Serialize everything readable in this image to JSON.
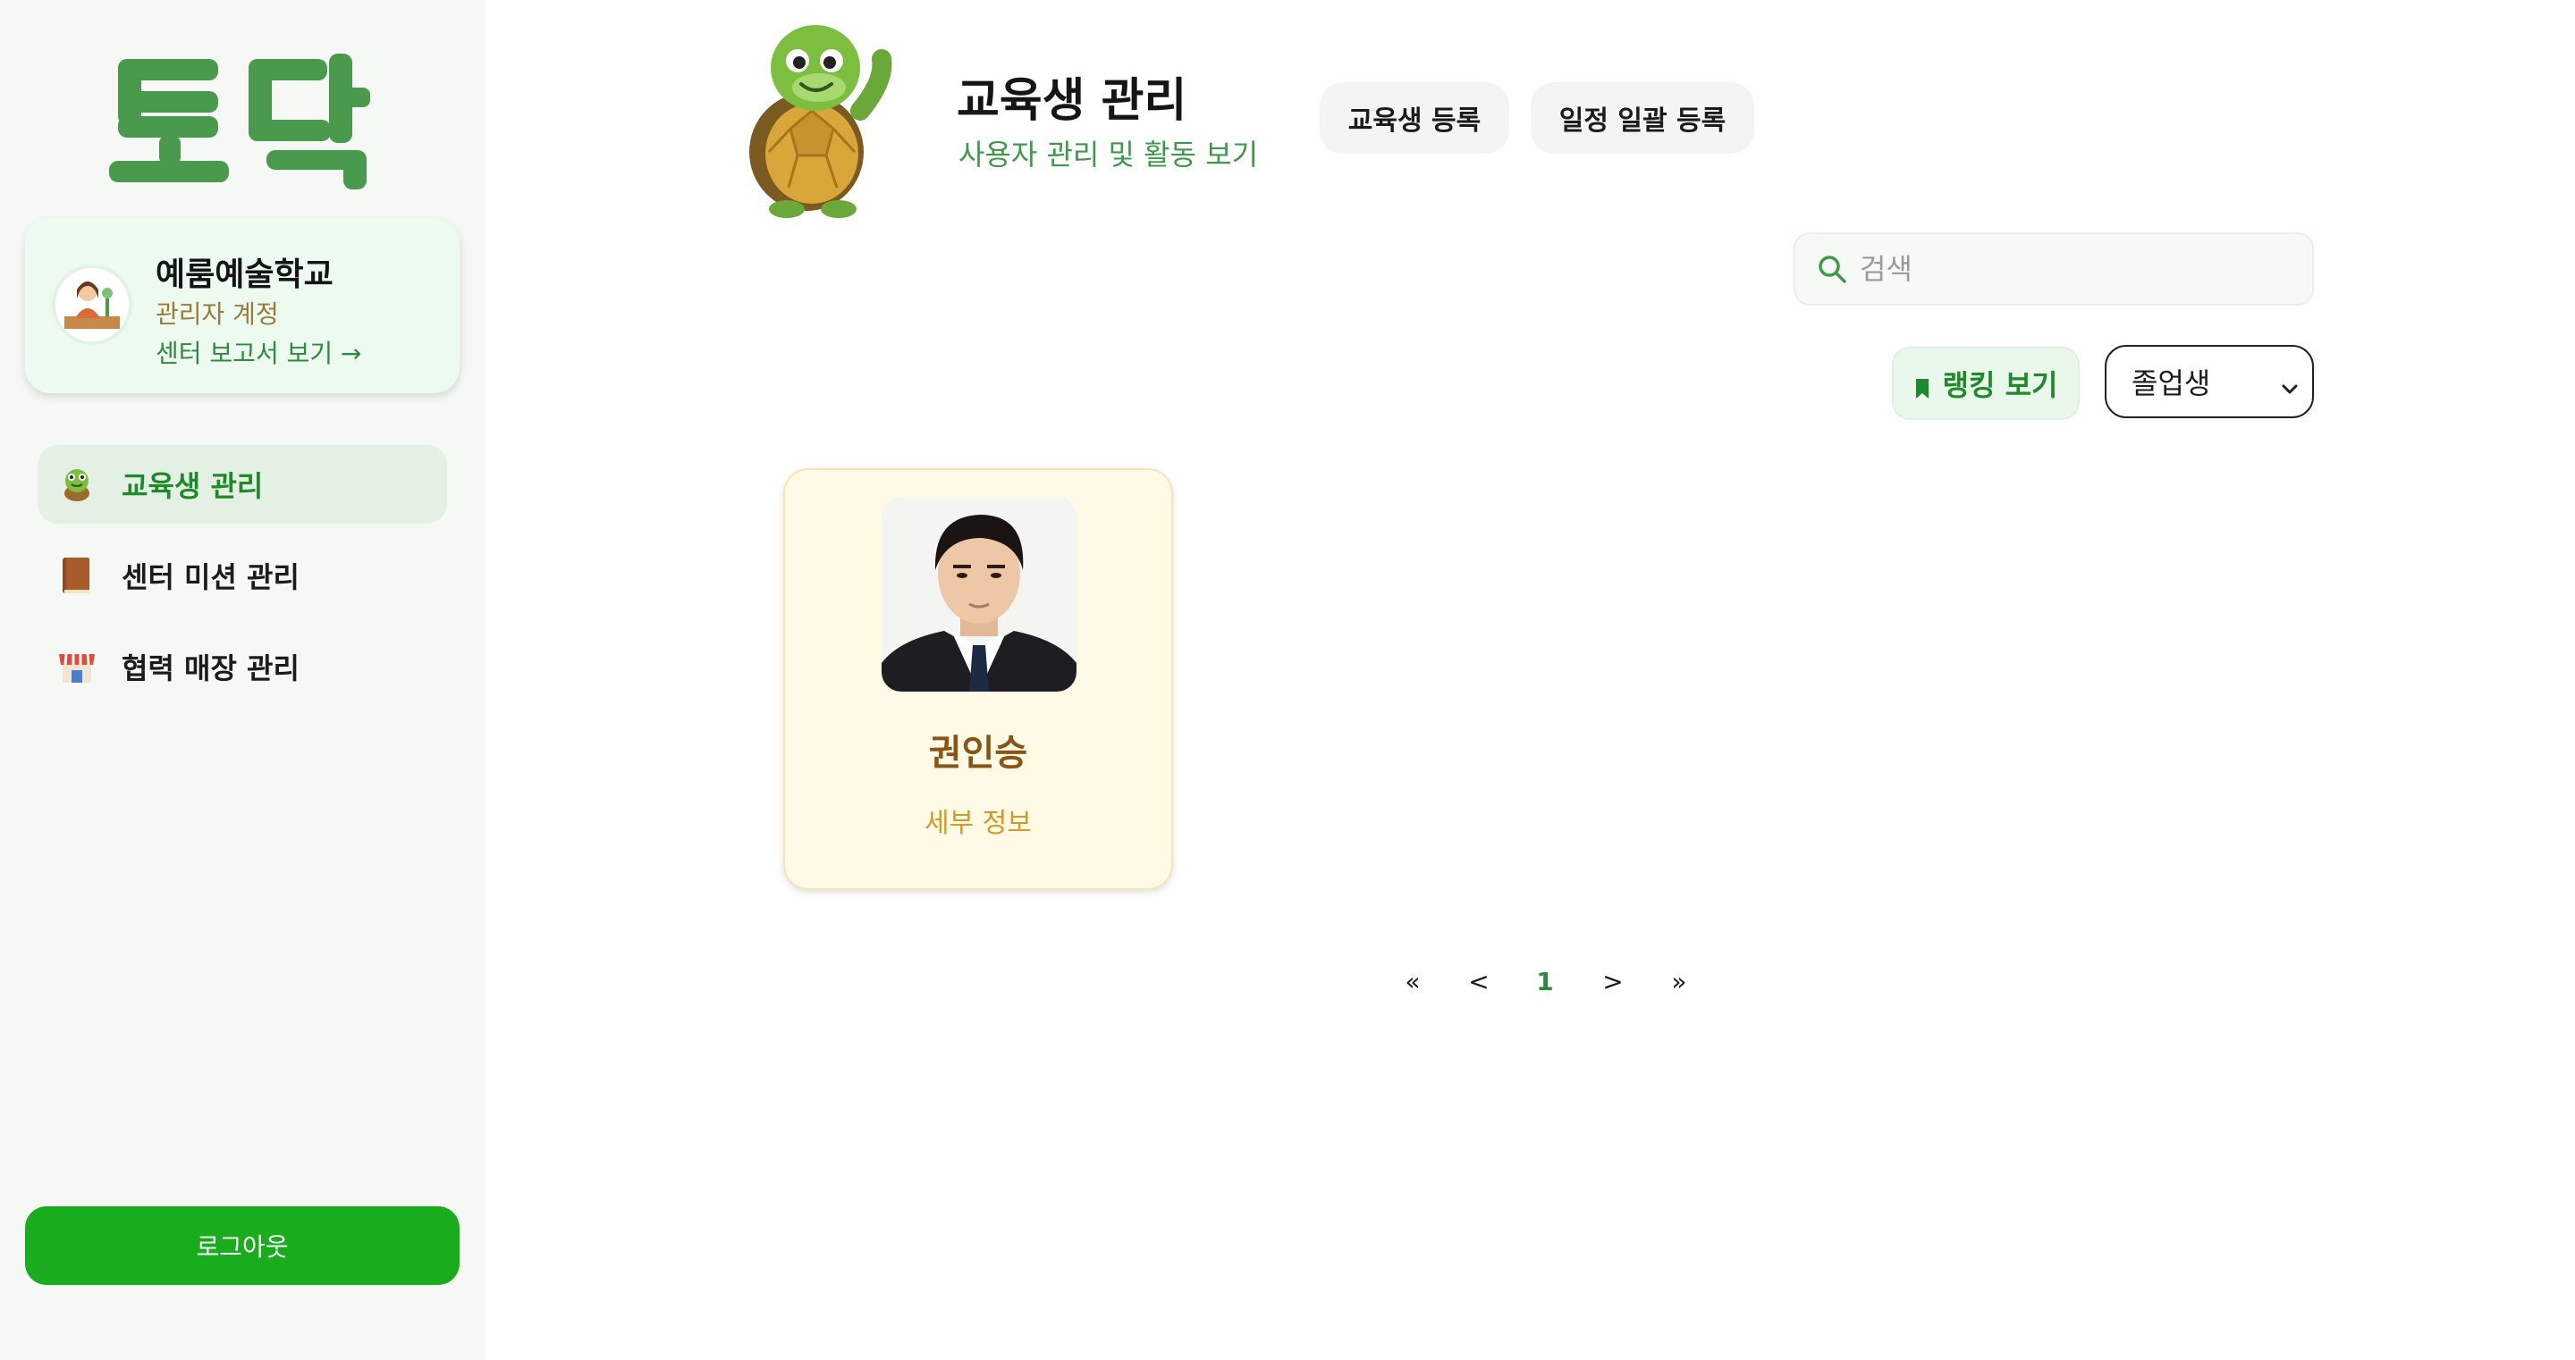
{
  "brand": {
    "logo_text": "토닥"
  },
  "profile": {
    "name": "예룸예술학교",
    "role": "관리자 계정",
    "report_link": "센터 보고서 보기 →"
  },
  "sidebar": {
    "items": [
      {
        "label": "교육생 관리",
        "icon": "turtle-icon",
        "active": true
      },
      {
        "label": "센터 미션 관리",
        "icon": "book-icon",
        "active": false
      },
      {
        "label": "협력 매장 관리",
        "icon": "store-icon",
        "active": false
      }
    ],
    "logout_label": "로그아웃"
  },
  "header": {
    "title": "교육생 관리",
    "subtitle": "사용자 관리 및 활동 보기",
    "register_button": "교육생 등록",
    "bulk_schedule_button": "일정 일괄 등록"
  },
  "search": {
    "placeholder": "검색",
    "value": ""
  },
  "controls": {
    "ranking_button": "랭킹 보기",
    "filter_selected": "졸업생"
  },
  "students": [
    {
      "name": "권인승",
      "detail_link": "세부 정보"
    }
  ],
  "pagination": {
    "first": "«",
    "prev": "<",
    "current": "1",
    "next": ">",
    "last": "»"
  },
  "colors": {
    "accent_green": "#19ad1e",
    "text_green": "#2e8a3c",
    "card_bg": "#fefae5",
    "card_name": "#8a5414"
  }
}
